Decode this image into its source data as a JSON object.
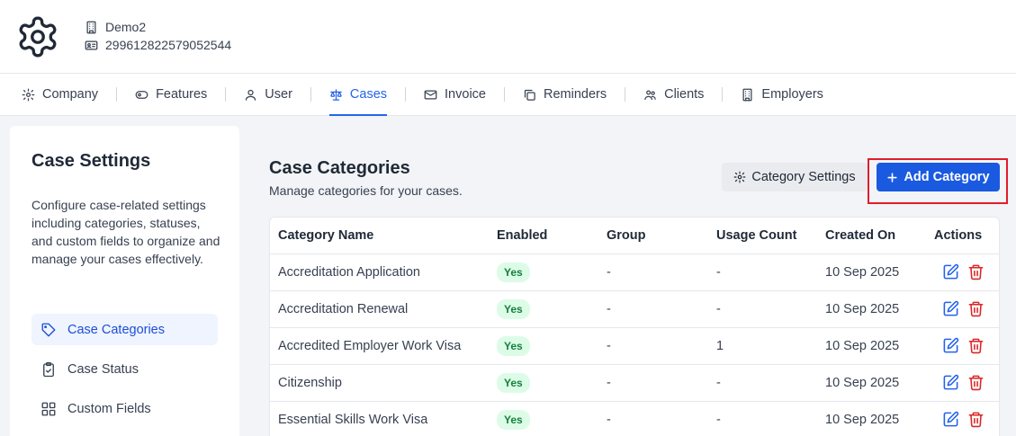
{
  "org": {
    "name": "Demo2",
    "id": "299612822579052544"
  },
  "tabs": [
    {
      "label": "Company",
      "icon": "gear-icon"
    },
    {
      "label": "Features",
      "icon": "toggle-icon"
    },
    {
      "label": "User",
      "icon": "user-icon"
    },
    {
      "label": "Cases",
      "icon": "scale-icon",
      "active": true
    },
    {
      "label": "Invoice",
      "icon": "mail-icon"
    },
    {
      "label": "Reminders",
      "icon": "copy-icon"
    },
    {
      "label": "Clients",
      "icon": "users-icon"
    },
    {
      "label": "Employers",
      "icon": "building-icon"
    }
  ],
  "sidebar": {
    "title": "Case Settings",
    "description": "Configure case-related settings including categories, statuses, and custom fields to organize and manage your cases effectively.",
    "items": [
      {
        "label": "Case Categories",
        "icon": "tag-icon",
        "active": true
      },
      {
        "label": "Case Status",
        "icon": "clipboard-check-icon"
      },
      {
        "label": "Custom Fields",
        "icon": "grid-icon"
      }
    ]
  },
  "main": {
    "title": "Case Categories",
    "subtitle": "Manage categories for your cases.",
    "settings_button": "Category Settings",
    "add_button": "Add Category"
  },
  "table": {
    "headers": [
      "Category Name",
      "Enabled",
      "Group",
      "Usage Count",
      "Created On",
      "Actions"
    ],
    "rows": [
      {
        "name": "Accreditation Application",
        "enabled": "Yes",
        "group": "-",
        "usage": "-",
        "created": "10 Sep 2025"
      },
      {
        "name": "Accreditation Renewal",
        "enabled": "Yes",
        "group": "-",
        "usage": "-",
        "created": "10 Sep 2025"
      },
      {
        "name": "Accredited Employer Work Visa",
        "enabled": "Yes",
        "group": "-",
        "usage": "1",
        "created": "10 Sep 2025"
      },
      {
        "name": "Citizenship",
        "enabled": "Yes",
        "group": "-",
        "usage": "-",
        "created": "10 Sep 2025"
      },
      {
        "name": "Essential Skills Work Visa",
        "enabled": "Yes",
        "group": "-",
        "usage": "-",
        "created": "10 Sep 2025"
      }
    ]
  },
  "colors": {
    "primary": "#1a5ae0",
    "active_tab": "#2563eb",
    "highlight": "#e11d2a",
    "success": "#15803d",
    "danger": "#dc2626"
  }
}
